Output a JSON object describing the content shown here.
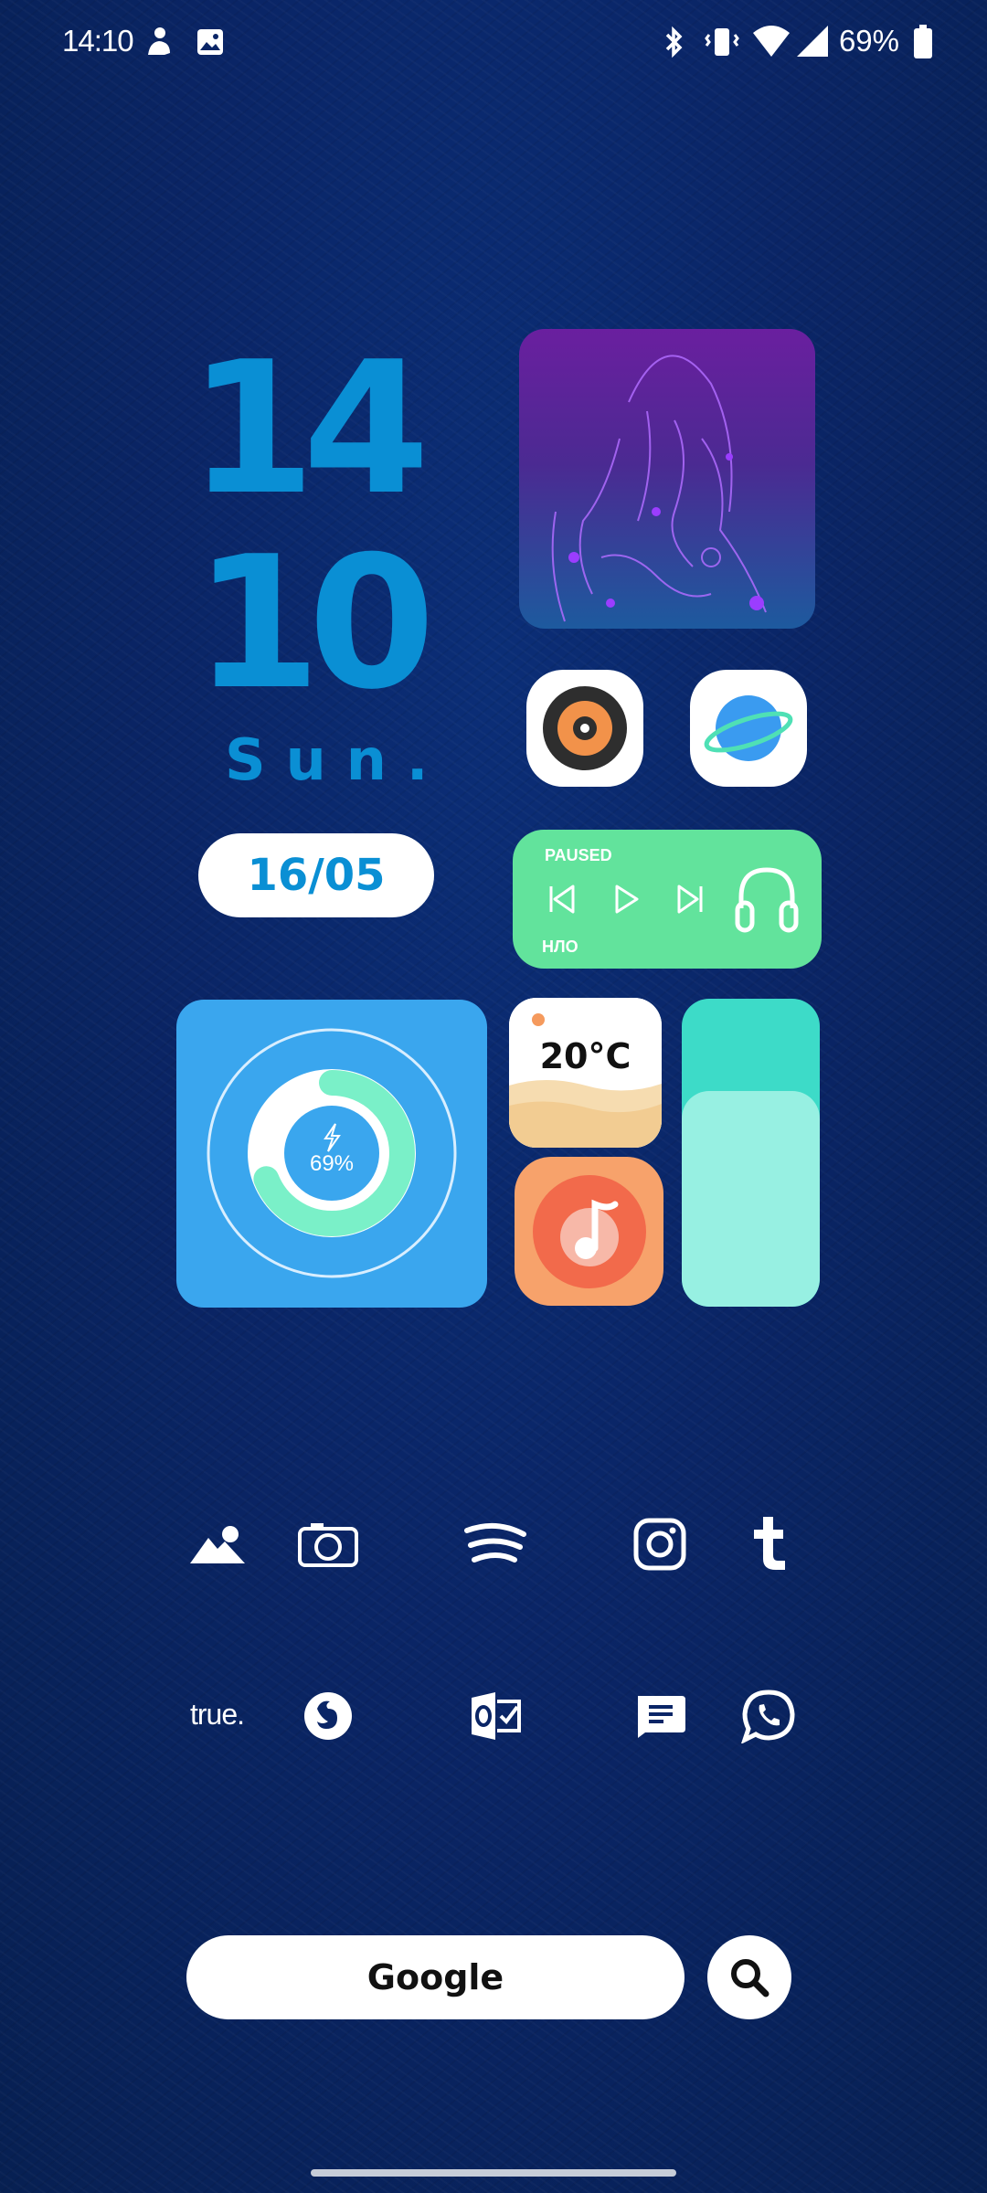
{
  "status_bar": {
    "time": "14:10",
    "battery_percent": "69%",
    "icons": [
      "notification-icon",
      "gallery-icon",
      "bluetooth-icon",
      "vibrate-icon",
      "wifi-icon",
      "signal-icon",
      "battery-icon"
    ]
  },
  "clock": {
    "hour": "14",
    "minute": "10",
    "day": "Sun.",
    "date": "16/05"
  },
  "music_widget": {
    "status": "PAUSED",
    "track": "НЛО"
  },
  "battery_widget": {
    "percent_label": "69%",
    "level": 0.69
  },
  "weather_widget": {
    "temperature": "20°C"
  },
  "volume_widget": {
    "level": 0.7
  },
  "apps": {
    "row1": [
      "gallery-icon",
      "camera-icon",
      "spotify-icon",
      "instagram-icon",
      "tumblr-icon"
    ],
    "row2_true_label": "true.",
    "row2": [
      "firefox-icon",
      "outlook-icon",
      "messages-icon",
      "whatsapp-icon"
    ]
  },
  "search": {
    "label": "Google"
  },
  "colors": {
    "accent": "#0a8fd4",
    "music_green": "#62e39c",
    "battery_blue": "#3aa6ee",
    "mint": "#97f0e2"
  }
}
